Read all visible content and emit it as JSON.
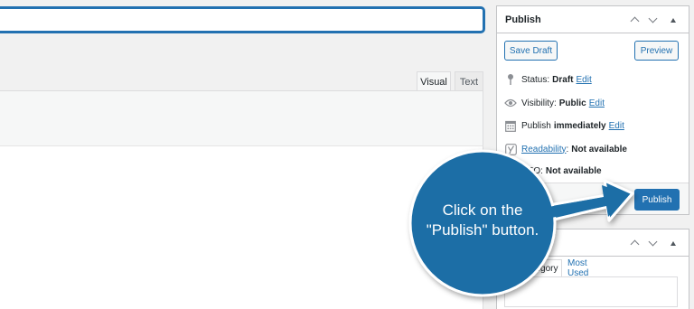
{
  "editor": {
    "tabs": [
      {
        "label": "Visual"
      },
      {
        "label": "Text"
      }
    ]
  },
  "publish_box": {
    "title": "Publish",
    "save_draft_label": "Save Draft",
    "preview_label": "Preview",
    "status": {
      "label": "Status:",
      "value": "Draft",
      "edit": "Edit"
    },
    "visibility": {
      "label": "Visibility:",
      "value": "Public",
      "edit": "Edit"
    },
    "publish_time": {
      "label": "Publish",
      "value": "immediately",
      "edit": "Edit"
    },
    "readability": {
      "label": "Readability",
      "suffix": ":",
      "value": "Not available"
    },
    "seo": {
      "label": "SEO:",
      "value": "Not available"
    },
    "publish_label": "Publish"
  },
  "categories_box": {
    "tabs": [
      {
        "label": "All Category"
      },
      {
        "label": "Most Used"
      }
    ]
  },
  "callout": {
    "line1": "Click on the",
    "line2": "\"Publish\" button.",
    "color": "#1f6ea6"
  },
  "icons": [
    "pin-icon",
    "eye-icon",
    "calendar-icon",
    "yoast-icon",
    "chevron-up-icon",
    "chevron-down-icon",
    "caret-up-icon"
  ]
}
